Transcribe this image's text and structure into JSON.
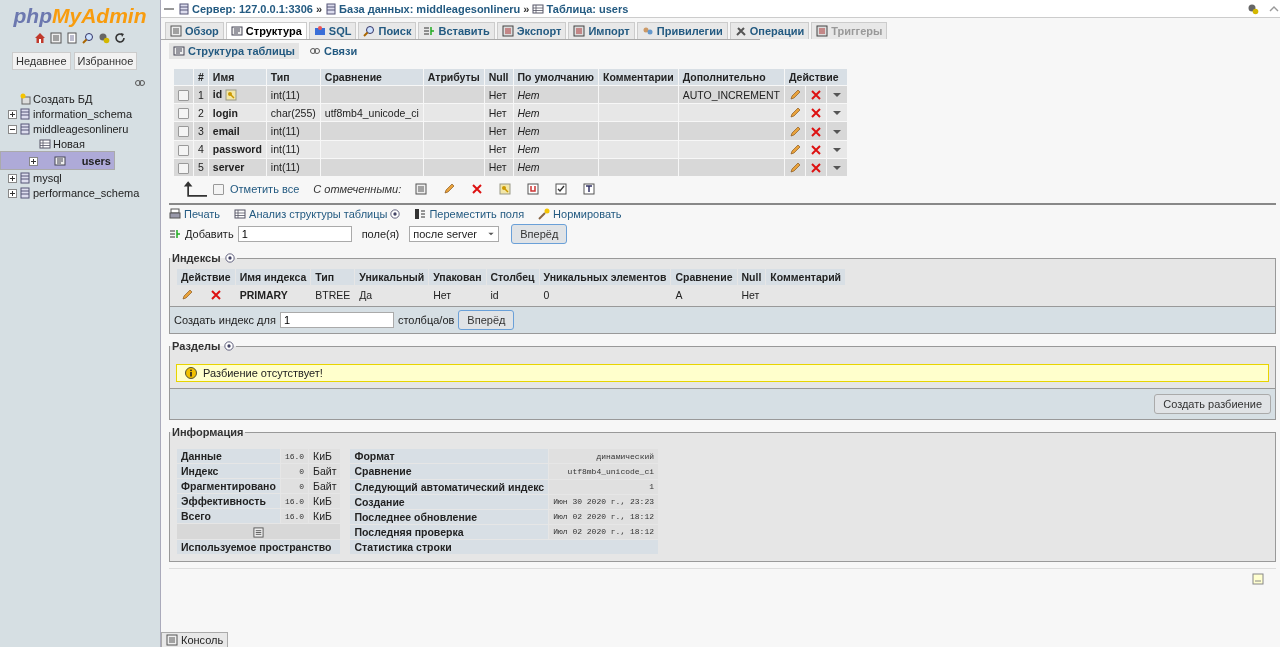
{
  "sidebar": {
    "logo_prefix": "php",
    "logo_suffix": "MyAdmin",
    "quick_tabs": [
      "Недавнее",
      "Избранное"
    ],
    "tree": [
      {
        "label": "Создать БД",
        "kind": "new",
        "selected": false
      },
      {
        "label": "information_schema",
        "kind": "db",
        "expanded": false,
        "selected": false
      },
      {
        "label": "middleagesonlineru",
        "kind": "db",
        "expanded": true,
        "selected": false,
        "children": [
          {
            "label": "Новая",
            "kind": "new_table",
            "selected": false
          },
          {
            "label": "users",
            "kind": "table",
            "expanded": false,
            "selected": true
          }
        ]
      },
      {
        "label": "mysql",
        "kind": "db",
        "expanded": false,
        "selected": false
      },
      {
        "label": "performance_schema",
        "kind": "db",
        "expanded": false,
        "selected": false
      }
    ]
  },
  "breadcrumb_separator": "»",
  "breadcrumb": [
    {
      "label": "Сервер: 127.0.0.1:3306"
    },
    {
      "label": "База данных: middleagesonlineru"
    },
    {
      "label": "Таблица: users"
    }
  ],
  "tabs": [
    {
      "label": "Обзор",
      "selected": false,
      "disabled": false
    },
    {
      "label": "Структура",
      "selected": true,
      "disabled": false
    },
    {
      "label": "SQL",
      "selected": false,
      "disabled": false
    },
    {
      "label": "Поиск",
      "selected": false,
      "disabled": false
    },
    {
      "label": "Вставить",
      "selected": false,
      "disabled": false
    },
    {
      "label": "Экспорт",
      "selected": false,
      "disabled": false
    },
    {
      "label": "Импорт",
      "selected": false,
      "disabled": false
    },
    {
      "label": "Привилегии",
      "selected": false,
      "disabled": false
    },
    {
      "label": "Операции",
      "selected": false,
      "disabled": false
    },
    {
      "label": "Триггеры",
      "selected": false,
      "disabled": true
    }
  ],
  "subtabs": [
    {
      "label": "Структура таблицы",
      "selected": true
    },
    {
      "label": "Связи",
      "selected": false
    }
  ],
  "structure": {
    "columns": [
      "#",
      "Имя",
      "Тип",
      "Сравнение",
      "Атрибуты",
      "Null",
      "По умолчанию",
      "Комментарии",
      "Дополнительно",
      "Действие"
    ],
    "rows": [
      {
        "num": "1",
        "name": "id",
        "primary": true,
        "type": "int(11)",
        "collation": "",
        "null": "Нет",
        "default": "Нет",
        "extra": "AUTO_INCREMENT",
        "checked": false
      },
      {
        "num": "2",
        "name": "login",
        "primary": false,
        "type": "char(255)",
        "collation": "utf8mb4_unicode_ci",
        "null": "Нет",
        "default": "Нет",
        "extra": "",
        "checked": false
      },
      {
        "num": "3",
        "name": "email",
        "primary": false,
        "type": "int(11)",
        "collation": "",
        "null": "Нет",
        "default": "Нет",
        "extra": "",
        "checked": false
      },
      {
        "num": "4",
        "name": "password",
        "primary": false,
        "type": "int(11)",
        "collation": "",
        "null": "Нет",
        "default": "Нет",
        "extra": "",
        "checked": false
      },
      {
        "num": "5",
        "name": "server",
        "primary": false,
        "type": "int(11)",
        "collation": "",
        "null": "Нет",
        "default": "Нет",
        "extra": "",
        "checked": false
      }
    ],
    "check_all": "Отметить все",
    "check_all_checked": false,
    "with_selected": "С отмеченными:"
  },
  "links": [
    "Печать",
    "Анализ структуры таблицы",
    "Переместить поля",
    "Нормировать"
  ],
  "add_fields": {
    "label": "Добавить",
    "value": "1",
    "unit": "поле(я)",
    "position": "после server",
    "button": "Вперёд"
  },
  "indexes": {
    "legend": "Индексы",
    "columns": [
      "Действие",
      "Имя индекса",
      "Тип",
      "Уникальный",
      "Упакован",
      "Столбец",
      "Уникальных элементов",
      "Сравнение",
      "Null",
      "Комментарий"
    ],
    "rows": [
      {
        "name": "PRIMARY",
        "type": "BTREE",
        "unique": "Да",
        "packed": "Нет",
        "column": "id",
        "cardinality": "0",
        "collation": "A",
        "null": "Нет"
      }
    ],
    "create_label": "Создать индекс для",
    "create_value": "1",
    "create_unit": "столбца/ов",
    "button": "Вперёд"
  },
  "partitions": {
    "legend": "Разделы",
    "notice": "Разбиение отсутствует!",
    "button": "Создать разбиение"
  },
  "info": {
    "legend": "Информация",
    "space": [
      {
        "label": "Данные",
        "value": "16.0",
        "unit": "КиБ"
      },
      {
        "label": "Индекс",
        "value": "0",
        "unit": "Байт"
      },
      {
        "label": "Фрагментировано",
        "value": "0",
        "unit": "Байт"
      },
      {
        "label": "Эффективность",
        "value": "16.0",
        "unit": "КиБ"
      },
      {
        "label": "Всего",
        "value": "16.0",
        "unit": "КиБ"
      }
    ],
    "space_title": "Используемое пространство",
    "stats": [
      {
        "label": "Формат",
        "value": "динамический"
      },
      {
        "label": "Сравнение",
        "value": "utf8mb4_unicode_ci"
      },
      {
        "label": "Следующий автоматический индекс",
        "value": "1"
      },
      {
        "label": "Создание",
        "value": "Июн 30 2020 г., 23:23"
      },
      {
        "label": "Последнее обновление",
        "value": "Июл 02 2020 г., 18:12"
      },
      {
        "label": "Последняя проверка",
        "value": "Июл 02 2020 г., 18:12"
      }
    ],
    "stats_title": "Статистика строки"
  },
  "console": "Консоль"
}
